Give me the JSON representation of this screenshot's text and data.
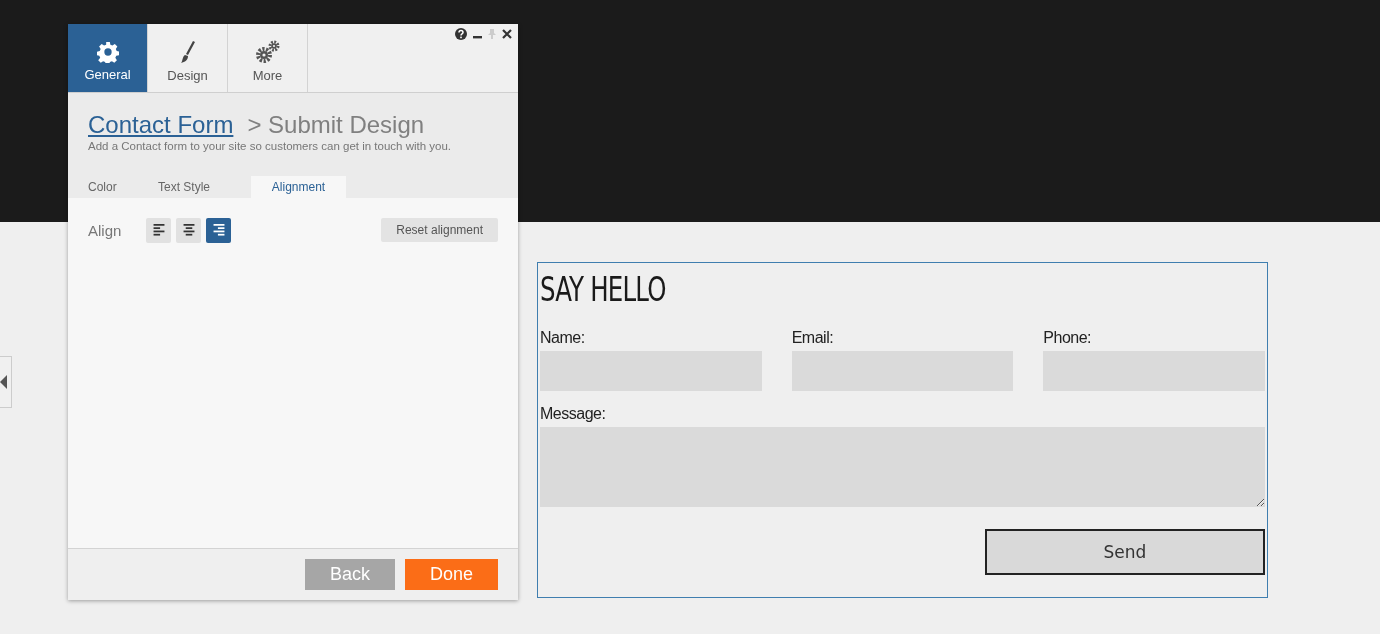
{
  "panel": {
    "tabs": [
      {
        "label": "General",
        "kind": "gear",
        "selected": true
      },
      {
        "label": "Design",
        "kind": "brush",
        "selected": false
      },
      {
        "label": "More",
        "kind": "gears",
        "selected": false
      }
    ],
    "breadcrumb": {
      "link": "Contact Form",
      "current": "> Submit Design"
    },
    "description": "Add a Contact form to your site so customers can get in touch with you.",
    "subtabs": [
      {
        "label": "Color",
        "selected": false
      },
      {
        "label": "Text Style",
        "selected": false
      },
      {
        "label": "Alignment",
        "selected": true
      }
    ],
    "align": {
      "label": "Align",
      "options": [
        {
          "kind": "left",
          "selected": false
        },
        {
          "kind": "center",
          "selected": false
        },
        {
          "kind": "right",
          "selected": true
        }
      ]
    },
    "reset_button": "Reset alignment",
    "buttons": [
      {
        "label": "Back",
        "kind": "secondary"
      },
      {
        "label": "Done",
        "kind": "primary"
      }
    ]
  },
  "form": {
    "title": "SAY HELLO",
    "fields": [
      {
        "label": "Name:"
      },
      {
        "label": "Email:"
      },
      {
        "label": "Phone:"
      }
    ],
    "message_label": "Message:",
    "submit": "Send"
  }
}
